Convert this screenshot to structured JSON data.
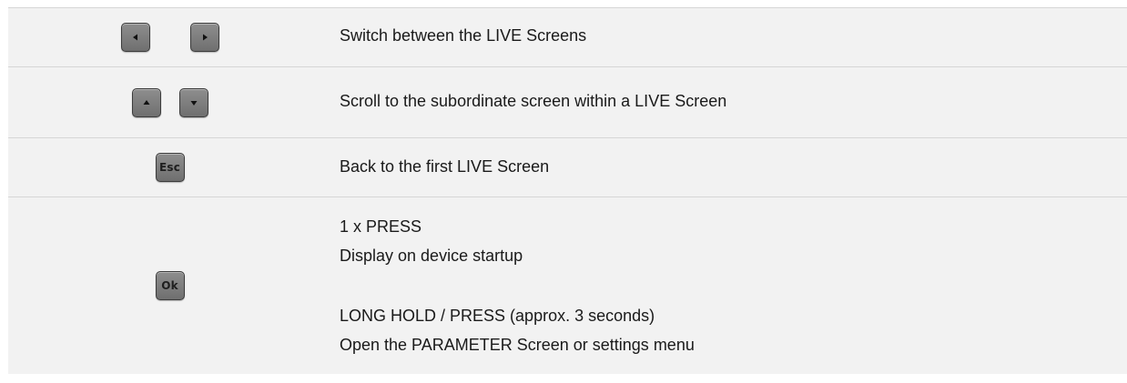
{
  "rows": [
    {
      "keys": [
        {
          "icon": "left-arrow-icon",
          "glyph": "◀"
        },
        {
          "icon": "right-arrow-icon",
          "glyph": "▶"
        }
      ],
      "description": "Switch between the LIVE Screens"
    },
    {
      "keys": [
        {
          "icon": "up-arrow-icon",
          "glyph": "▲"
        },
        {
          "icon": "down-arrow-icon",
          "glyph": "▼"
        }
      ],
      "description": "Scroll to the subordinate screen within a LIVE Screen"
    },
    {
      "keys": [
        {
          "label": "Esc"
        }
      ],
      "description": "Back to the first  LIVE Screen"
    },
    {
      "keys": [
        {
          "label": "Ok"
        }
      ],
      "description_lines": [
        "1 x PRESS",
        "Display on device startup",
        "LONG HOLD / PRESS (approx. 3 seconds)",
        "Open the PARAMETER Screen or settings menu"
      ]
    }
  ],
  "colors": {
    "panel_background": "#f2f2f2",
    "key_fill": "#7f7f7f",
    "key_border": "#3c3c3c",
    "divider": "#d6d6d6",
    "text": "#1a1a1a"
  }
}
